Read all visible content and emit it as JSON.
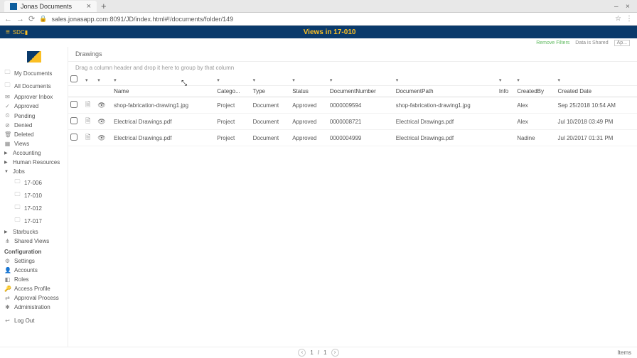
{
  "browser": {
    "tab_title": "Jonas Documents",
    "url": "sales.jonasapp.com:8091/JD/index.html#!/documents/folder/149",
    "new_tab_icon": "+",
    "close_tab": "×",
    "win_min": "–",
    "win_max": "□",
    "win_close": "×",
    "back": "←",
    "forward": "→",
    "reload": "⟳",
    "lock": "🔒",
    "star": "☆",
    "menu": "⋮"
  },
  "header": {
    "menu_icon": "≡",
    "brand": "SDC▮",
    "title": "Views in 17-010"
  },
  "status": {
    "remove_filters": "Remove Filters",
    "data_shared": "Data is Shared",
    "apply": "Ap..."
  },
  "sidebar": {
    "my_documents": "My Documents",
    "all_documents": "All Documents",
    "approver_inbox": "Approver Inbox",
    "approved": "Approved",
    "pending": "Pending",
    "denied": "Denied",
    "deleted": "Deleted",
    "views": "Views",
    "accounting": "Accounting",
    "hr": "Human Resources",
    "jobs": "Jobs",
    "job_006": "17-006",
    "job_010": "17-010",
    "job_012": "17-012",
    "job_017": "17-017",
    "starbucks": "Starbucks",
    "shared_views": "Shared Views",
    "config_header": "Configuration",
    "settings": "Settings",
    "accounts": "Accounts",
    "roles": "Roles",
    "access_profile": "Access Profile",
    "approval_process": "Approval Process",
    "administration": "Administration",
    "logout": "Log Out"
  },
  "main": {
    "breadcrumb": "Drawings",
    "group_hint": "Drag a column header and drop it here to group by that column"
  },
  "columns": {
    "name": "Name",
    "category": "Catego...",
    "type": "Type",
    "status": "Status",
    "doc_number": "DocumentNumber",
    "doc_path": "DocumentPath",
    "info": "Info",
    "created_by": "CreatedBy",
    "created_date": "Created Date"
  },
  "rows": [
    {
      "name": "shop-fabrication-drawing1.jpg",
      "category": "Project",
      "type": "Document",
      "status": "Approved",
      "doc_number": "0000009594",
      "doc_path": "shop-fabrication-drawing1.jpg",
      "info": "",
      "created_by": "Alex",
      "created_date": "Sep 25/2018 10:54 AM"
    },
    {
      "name": "Electrical Drawings.pdf",
      "category": "Project",
      "type": "Document",
      "status": "Approved",
      "doc_number": "0000008721",
      "doc_path": "Electrical Drawings.pdf",
      "info": "",
      "created_by": "Alex",
      "created_date": "Jul 10/2018 03:49 PM"
    },
    {
      "name": "Electrical Drawings.pdf",
      "category": "Project",
      "type": "Document",
      "status": "Approved",
      "doc_number": "0000004999",
      "doc_path": "Electrical Drawings.pdf",
      "info": "",
      "created_by": "Nadine",
      "created_date": "Jul 20/2017 01:31 PM"
    }
  ],
  "footer": {
    "prev": "‹",
    "page": "1",
    "sep": "/",
    "total": "1",
    "next": "›",
    "items": "Items"
  },
  "filter_icon": "▾"
}
